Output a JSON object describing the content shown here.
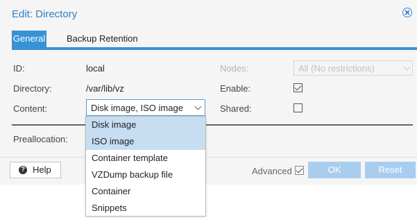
{
  "window": {
    "title": "Edit: Directory",
    "close_icon": "close-icon"
  },
  "tabs": [
    {
      "label": "General",
      "active": true
    },
    {
      "label": "Backup Retention",
      "active": false
    }
  ],
  "form": {
    "id": {
      "label": "ID:",
      "value": "local"
    },
    "directory": {
      "label": "Directory:",
      "value": "/var/lib/vz"
    },
    "content": {
      "label": "Content:",
      "value": "Disk image, ISO image"
    },
    "nodes": {
      "label": "Nodes:",
      "value": "All (No restrictions)",
      "disabled": true
    },
    "enable": {
      "label": "Enable:",
      "checked": true
    },
    "shared": {
      "label": "Shared:",
      "checked": false
    },
    "preallocation": {
      "label": "Preallocation:"
    }
  },
  "dropdown": {
    "options": [
      {
        "label": "Disk image",
        "selected": true
      },
      {
        "label": "ISO image",
        "selected": true
      },
      {
        "label": "Container template",
        "selected": false
      },
      {
        "label": "VZDump backup file",
        "selected": false
      },
      {
        "label": "Container",
        "selected": false
      },
      {
        "label": "Snippets",
        "selected": false
      }
    ]
  },
  "footer": {
    "help": "Help",
    "advanced": "Advanced",
    "advanced_checked": true,
    "ok": "OK",
    "reset": "Reset"
  },
  "colors": {
    "accent": "#3892d4",
    "title": "#2f7fc1",
    "selected_option": "#c6ddf2",
    "disabled_button": "#a8cdef"
  }
}
